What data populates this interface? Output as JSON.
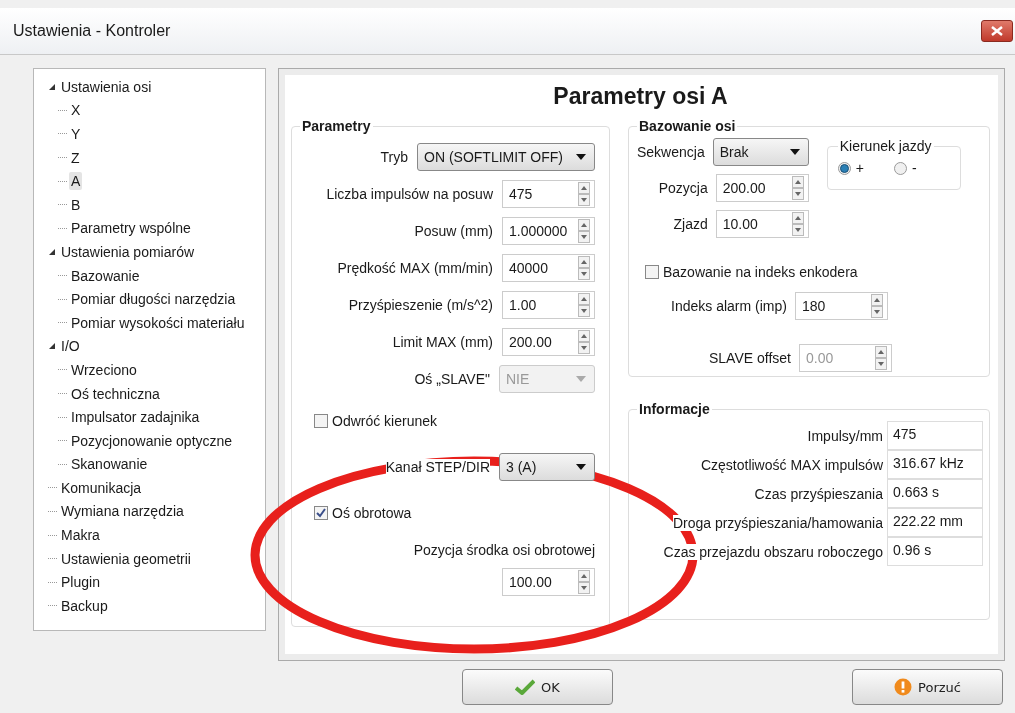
{
  "window": {
    "title": "Ustawienia - Kontroler"
  },
  "tree": [
    {
      "label": "Ustawienia osi",
      "selected": false,
      "expanded": true,
      "children": [
        {
          "label": "X",
          "selected": false
        },
        {
          "label": "Y",
          "selected": false
        },
        {
          "label": "Z",
          "selected": false
        },
        {
          "label": "A",
          "selected": true
        },
        {
          "label": "B",
          "selected": false
        },
        {
          "label": "Parametry wspólne",
          "selected": false
        }
      ]
    },
    {
      "label": "Ustawienia pomiarów",
      "selected": false,
      "expanded": true,
      "children": [
        {
          "label": "Bazowanie",
          "selected": false
        },
        {
          "label": "Pomiar długości narzędzia",
          "selected": false
        },
        {
          "label": "Pomiar wysokości materiału",
          "selected": false
        }
      ]
    },
    {
      "label": "I/O",
      "selected": false,
      "expanded": true,
      "children": [
        {
          "label": "Wrzeciono",
          "selected": false
        },
        {
          "label": "Oś techniczna",
          "selected": false
        },
        {
          "label": "Impulsator zadajnika",
          "selected": false
        },
        {
          "label": "Pozycjonowanie optyczne",
          "selected": false
        },
        {
          "label": "Skanowanie",
          "selected": false
        }
      ]
    },
    {
      "label": "Komunikacja",
      "selected": false
    },
    {
      "label": "Wymiana narzędzia",
      "selected": false
    },
    {
      "label": "Makra",
      "selected": false
    },
    {
      "label": "Ustawienia geometrii",
      "selected": false
    },
    {
      "label": "Plugin",
      "selected": false
    },
    {
      "label": "Backup",
      "selected": false
    }
  ],
  "heading": "Parametry osi A",
  "parametry": {
    "title": "Parametry",
    "rows": [
      {
        "kind": "dropdown",
        "label": "Tryb",
        "value": "ON (SOFTLIMIT OFF)",
        "disabled": false,
        "wide": true
      },
      {
        "kind": "spin",
        "label": "Liczba impulsów na posuw",
        "value": "475",
        "disabled": false
      },
      {
        "kind": "spin",
        "label": "Posuw (mm)",
        "value": "1.000000",
        "disabled": false
      },
      {
        "kind": "spin",
        "label": "Prędkość MAX (mm/min)",
        "value": "40000",
        "disabled": false
      },
      {
        "kind": "spin",
        "label": "Przyśpieszenie (m/s^2)",
        "value": "1.00",
        "disabled": false
      },
      {
        "kind": "spin",
        "label": "Limit MAX (mm)",
        "value": "200.00",
        "disabled": false
      },
      {
        "kind": "dropdown",
        "label": "Oś „SLAVE\"",
        "value": "NIE",
        "disabled": true,
        "wide": false
      },
      {
        "kind": "checkbox",
        "label": "Odwróć kierunek",
        "checked": false
      },
      {
        "kind": "dropdown",
        "label": "Kanał STEP/DIR",
        "value": "3 (A)",
        "disabled": false,
        "wide": false
      },
      {
        "kind": "checkbox",
        "label": "Oś obrotowa",
        "checked": true
      },
      {
        "kind": "text",
        "label": "Pozycja środka osi obrotowej"
      },
      {
        "kind": "spin",
        "value": "100.00",
        "disabled": false
      }
    ]
  },
  "bazowanie": {
    "title": "Bazowanie osi",
    "sekwencja": {
      "label": "Sekwencja",
      "value": "Brak"
    },
    "pozycja": {
      "label": "Pozycja",
      "value": "200.00"
    },
    "zjazd": {
      "label": "Zjazd",
      "value": "10.00"
    },
    "kierunek": {
      "title": "Kierunek jazdy",
      "options": [
        {
          "label": "+",
          "selected": true
        },
        {
          "label": "-",
          "selected": false
        }
      ]
    },
    "encoder": {
      "label": "Bazowanie na indeks enkodera",
      "checked": false
    },
    "indeks": {
      "label": "Indeks alarm (imp)",
      "value": "180",
      "disabled": false
    },
    "slave_offset": {
      "label": "SLAVE offset",
      "value": "0.00",
      "disabled": true
    }
  },
  "informacje": {
    "title": "Informacje",
    "rows": [
      {
        "label": "Impulsy/mm",
        "value": "475"
      },
      {
        "label": "Częstotliwość MAX impulsów",
        "value": "316.67 kHz"
      },
      {
        "label": "Czas przyśpieszania",
        "value": "0.663 s"
      },
      {
        "label": "Droga przyśpieszania/hamowania",
        "value": "222.22 mm"
      },
      {
        "label": "Czas przejazdu obszaru roboczego",
        "value": "0.96 s"
      }
    ]
  },
  "buttons": [
    {
      "kind": "ok",
      "label": "OK"
    },
    {
      "kind": "cancel",
      "label": "Porzuć"
    }
  ]
}
